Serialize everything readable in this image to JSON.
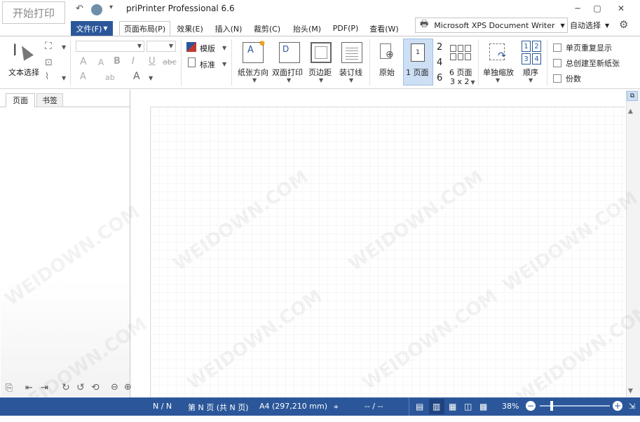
{
  "app": {
    "start_print": "开始打印",
    "title": "priPrinter Professional 6.6"
  },
  "tabs": {
    "file": "文件(F)",
    "items": [
      "页面布局(P)",
      "效果(E)",
      "插入(N)",
      "裁剪(C)",
      "抬头(M)",
      "PDF(P)",
      "查看(W)"
    ]
  },
  "printer": {
    "name": "Microsoft XPS Document Writer",
    "auto_select": "自动选择"
  },
  "ribbon": {
    "text_select": "文本选择",
    "template": "模版",
    "standard": "标准",
    "paper_orientation": "纸张方向",
    "duplex_print": "双面打印",
    "margins": "页边距",
    "binding_line": "装订线",
    "original": "原始",
    "one_page": "1 页面",
    "nums": [
      "2",
      "4",
      "6"
    ],
    "six_pages": "6 页面",
    "grid_3x2": "3 x 2",
    "single_zoom": "单独缩放",
    "order": "顺序",
    "order_nums": [
      "1",
      "2",
      "3",
      "4"
    ],
    "chk_repeat": "单页重复显示",
    "chk_new_paper": "总创建至新纸张",
    "chk_copies": "份数",
    "font_a_big": "A",
    "font_a_small": "A",
    "bold": "B",
    "italic": "I",
    "underline": "U",
    "strike": "abc"
  },
  "panel": {
    "tab_pages": "页面",
    "tab_bookmarks": "书签"
  },
  "status": {
    "page_nn": "N / N",
    "page_info": "第 N 页 (共 N 页)",
    "paper": "A4 (297,210 mm)",
    "coords": "-- / --",
    "zoom": "38%"
  },
  "watermark": "WEIDOWN.COM",
  "colors": {
    "accent": "#2b579a",
    "status_bg": "#2b579a"
  }
}
